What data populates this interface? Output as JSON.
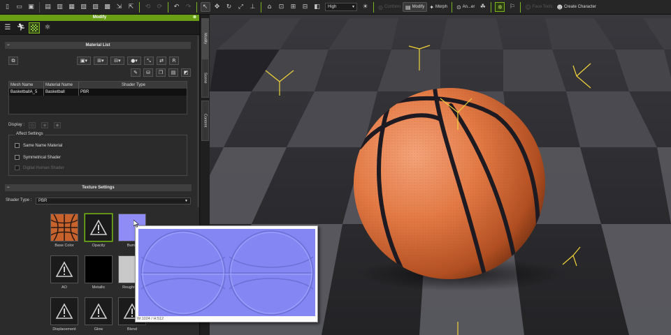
{
  "toolbar": {
    "left_icons": [
      "new-file-icon",
      "open-folder-icon",
      "save-icon",
      "new-project-icon",
      "import-icon",
      "export-icon",
      "merge-icon",
      "load-icon",
      "pack-icon",
      "render-icon",
      "export-fbx-icon"
    ],
    "quality_value": "High",
    "modify_label": "Modify",
    "morph_label": "Morph",
    "animation_label": "An...er",
    "conform_label": "Conform",
    "face_tools_label": "Face Tools",
    "create_character_label": "Create Character"
  },
  "panel": {
    "title": "Modify",
    "close_glyph": "⊗",
    "material_list_title": "Material List",
    "table": {
      "headers": [
        "Mesh Name",
        "Material Name",
        "Shader Type"
      ],
      "rows": [
        [
          "BasketballA_5",
          "Basketball",
          "PBR"
        ]
      ]
    },
    "display_label": "Display :",
    "affect_settings": {
      "title": "Affect Settings",
      "options": [
        "Same Name Material",
        "Symmetrical Shader",
        "Digital Human Shader"
      ]
    },
    "texture_settings_title": "Texture Settings",
    "shader_type_label": "Shader Type :",
    "shader_type_value": "PBR",
    "texture_slots": [
      "Base Color",
      "Opacity",
      "Bump",
      "AO",
      "Metallic",
      "Roughness",
      "Displacement",
      "Glow",
      "Blend"
    ]
  },
  "side_tabs": [
    "Modify",
    "Scene",
    "Content"
  ],
  "preview": {
    "caption": "W:1024 / H:512"
  },
  "colors": {
    "accent_green": "#7ab51d",
    "panel_bg": "#2b2b2b",
    "basketball_orange": "#d9743e",
    "normal_map_blue": "#8487f3"
  }
}
